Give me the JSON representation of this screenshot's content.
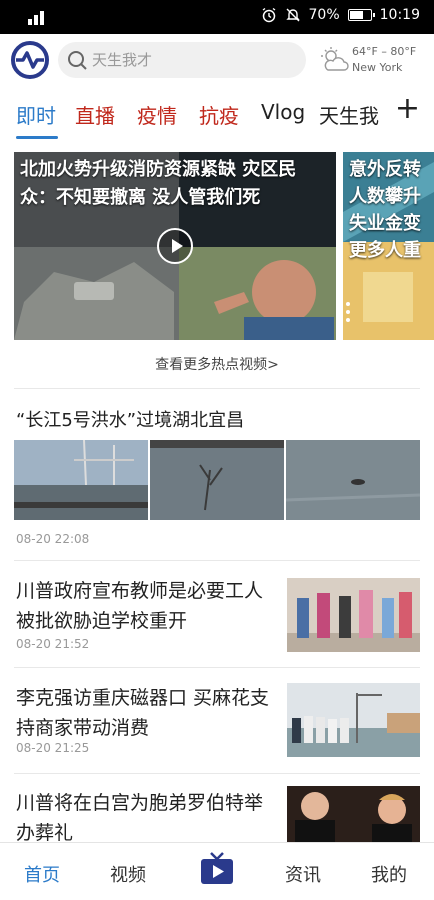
{
  "status_bar": {
    "battery": "70%",
    "time": "10:19",
    "battery_fraction": 0.7
  },
  "header": {
    "search_placeholder": "天生我才",
    "weather": {
      "temp": "64°F – 80°F",
      "city": "New York"
    }
  },
  "tabs": [
    {
      "label": "即时",
      "style": "active"
    },
    {
      "label": "直播",
      "style": "red"
    },
    {
      "label": "疫情",
      "style": "red"
    },
    {
      "label": "抗疫",
      "style": "red"
    },
    {
      "label": "Vlog",
      "style": "plain"
    },
    {
      "label": "天生我",
      "style": "plain"
    }
  ],
  "add_tab_label": "+",
  "carousel": {
    "slides": [
      {
        "title": "北加火势升级消防资源紧缺 灾区民众：不知要撤离 没人管我们死"
      },
      {
        "title": "意外反转 人数攀升 失业金变 更多人重"
      }
    ],
    "more_link": "查看更多热点视频>"
  },
  "news_feature": {
    "title": "“长江5号洪水”过境湖北宜昌",
    "time": "08-20 22:08"
  },
  "news_list": [
    {
      "title": "川普政府宣布教师是必要工人 被批欲胁迫学校重开",
      "time": "08-20 21:52"
    },
    {
      "title": "李克强访重庆磁器口 买麻花支持商家带动消费",
      "time": "08-20 21:25"
    },
    {
      "title": "川普将在白宫为胞弟罗伯特举办葬礼",
      "time": ""
    }
  ],
  "bottom_nav": {
    "home": "首页",
    "video": "视频",
    "news": "资讯",
    "me": "我的"
  },
  "colors": {
    "accent": "#2c7bc9",
    "red_tab": "#c0281c",
    "logo": "#2a3a8c"
  }
}
